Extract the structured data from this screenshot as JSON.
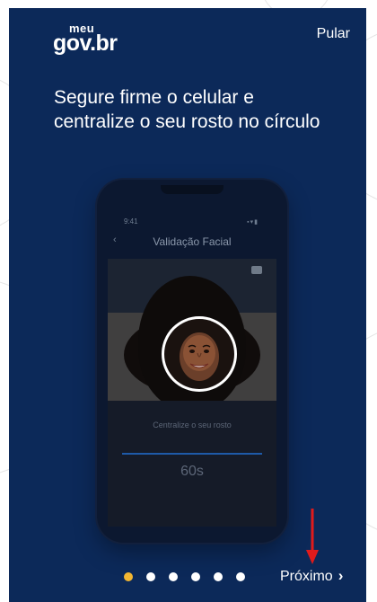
{
  "header": {
    "logo_small": "meu",
    "logo_main": "gov.br",
    "skip_label": "Pular"
  },
  "headline": {
    "line1": "Segure firme o celular e",
    "line2": "centralize o seu rosto no círculo"
  },
  "phone_mock": {
    "time": "9:41",
    "status_icons": "▪▾▮",
    "title": "Validação Facial",
    "hint": "Centralize o seu rosto",
    "timer": "60s"
  },
  "pagination": {
    "total": 6,
    "active_index": 0,
    "active_color": "#f2b632",
    "inactive_color": "#ffffff"
  },
  "footer": {
    "next_label": "Próximo",
    "next_icon": "chevron-right-icon"
  },
  "annotation": {
    "arrow_color": "#e01b1b",
    "arrow_icon": "red-arrow-down-icon"
  },
  "colors": {
    "background": "#0c2959",
    "text": "#ffffff"
  }
}
